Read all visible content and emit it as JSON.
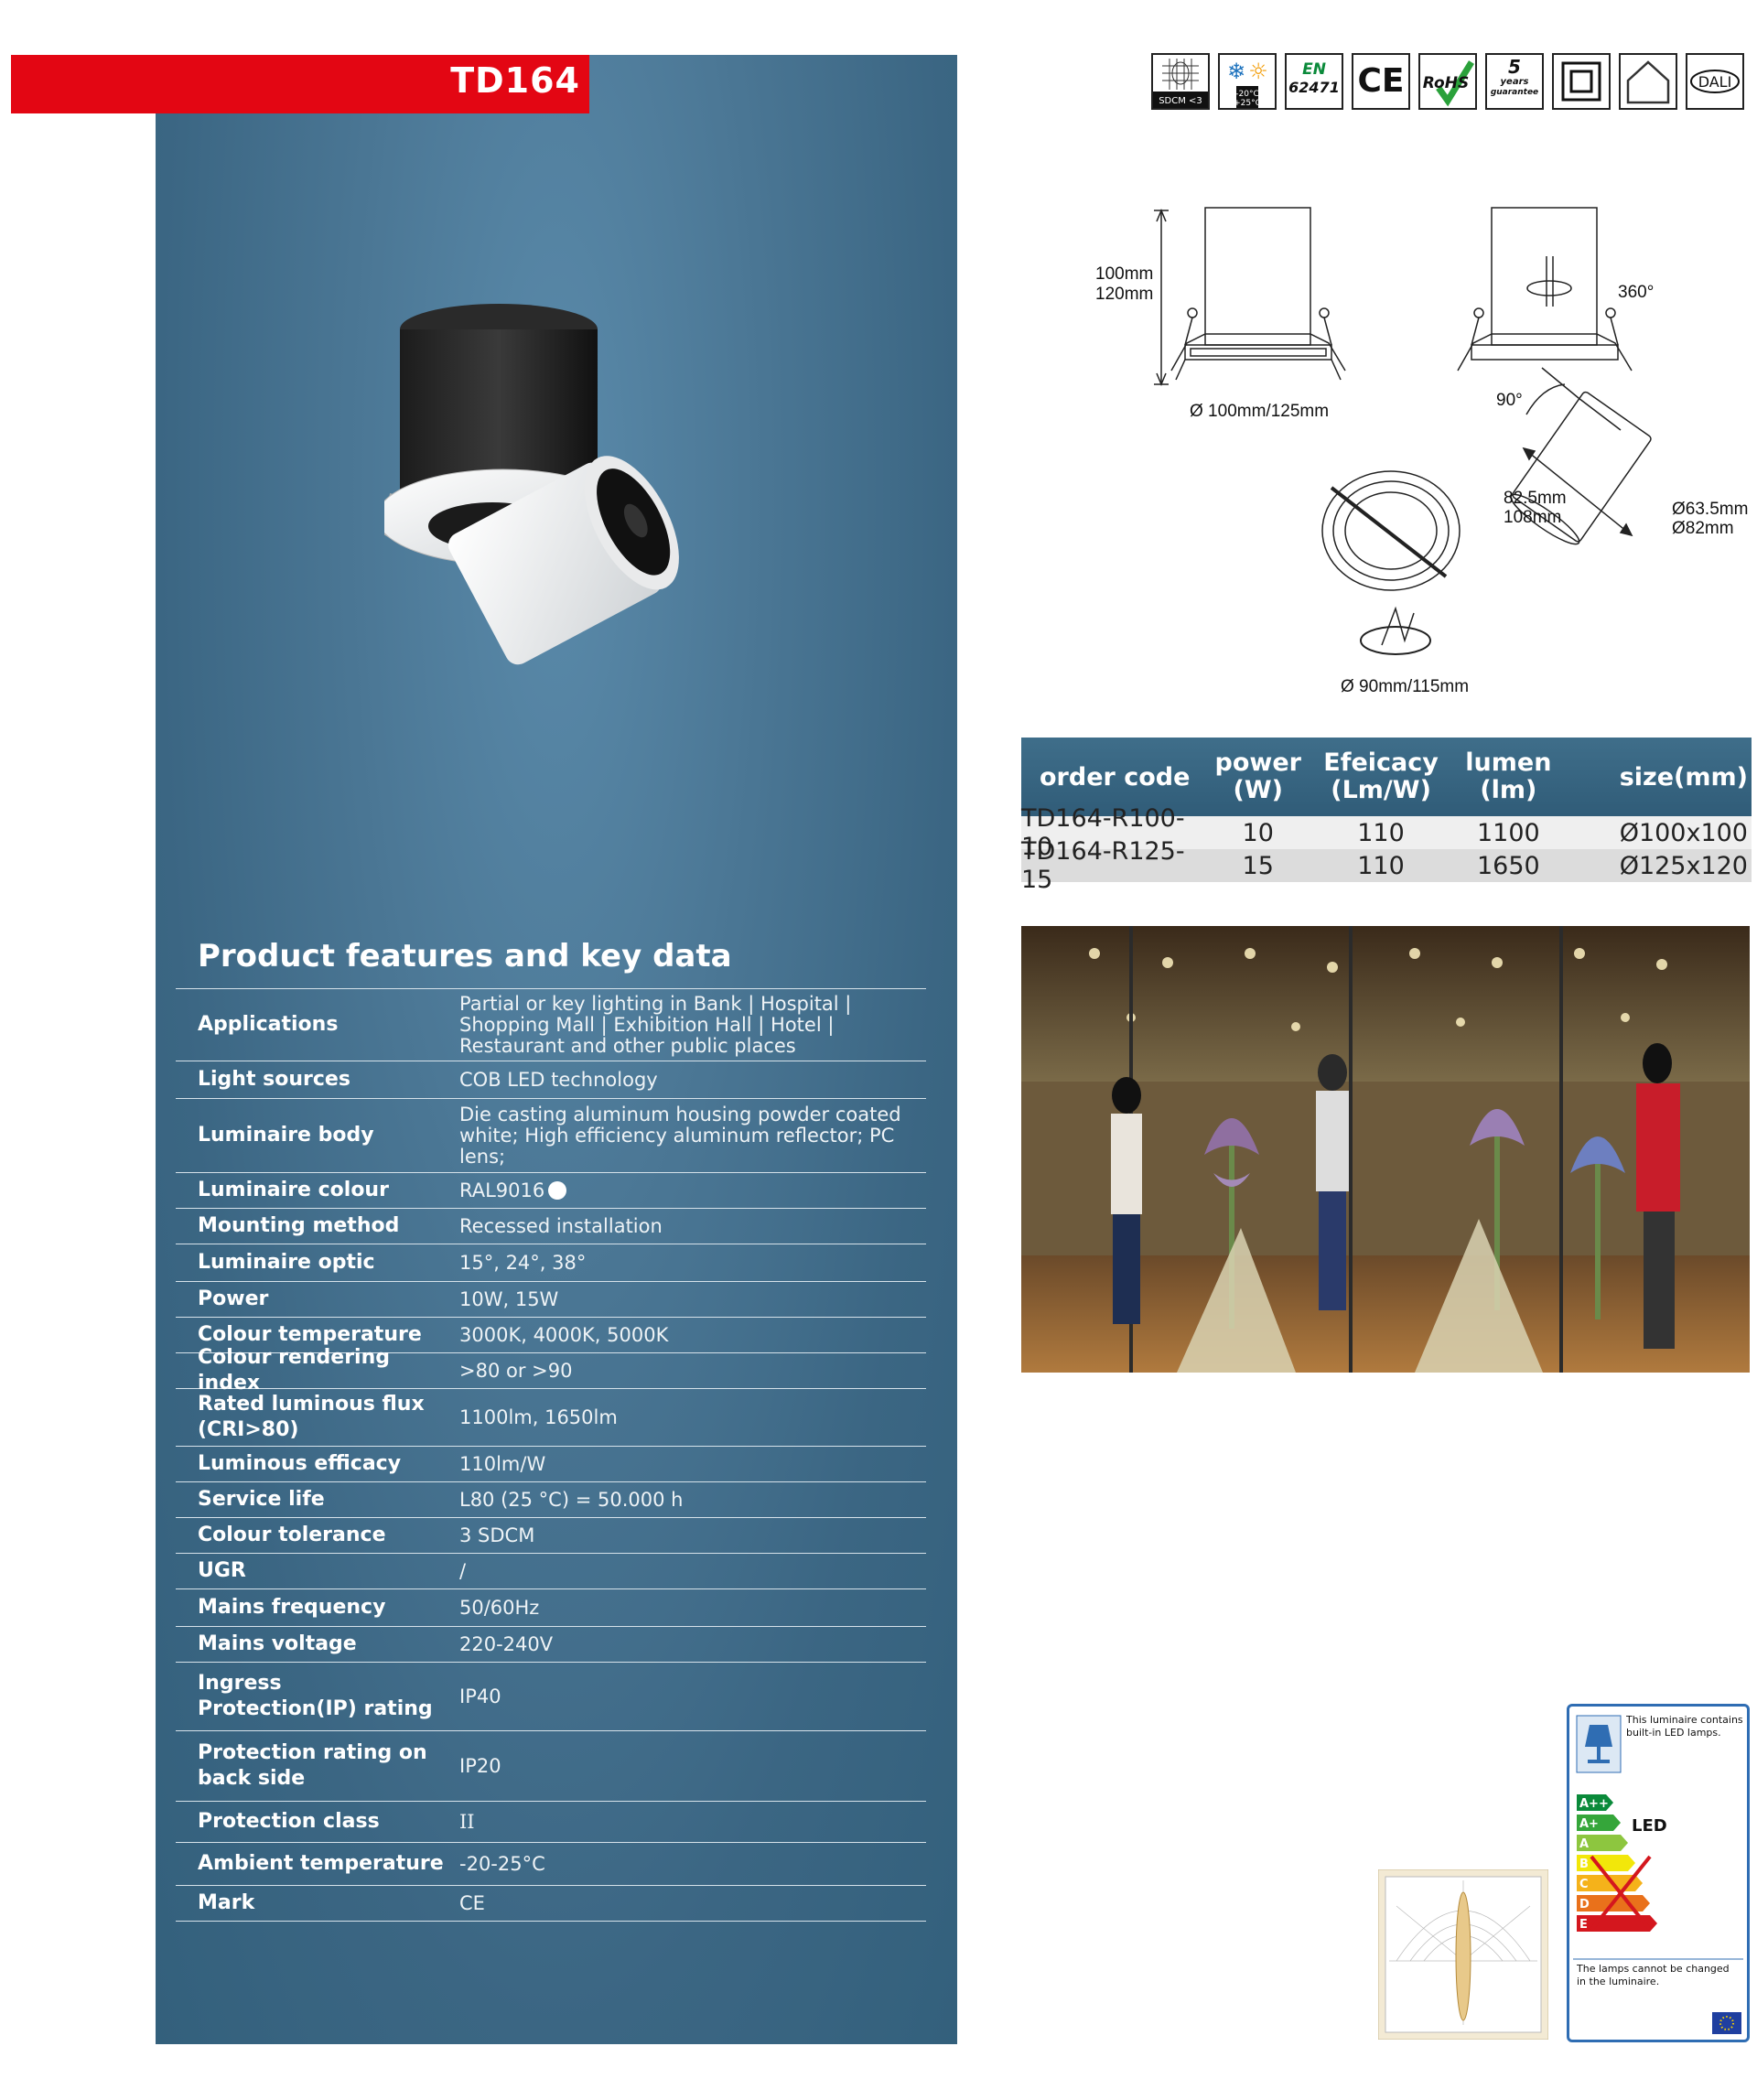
{
  "header": {
    "model": "TD164"
  },
  "certifications": [
    {
      "icon": "sdcm-icon",
      "label": "SDCM <3"
    },
    {
      "icon": "temperature-icon",
      "label": "-20°C\n+25°C"
    },
    {
      "icon": "en-standard-icon",
      "line1": "EN",
      "line2": "62471"
    },
    {
      "icon": "ce-icon",
      "label": "CE"
    },
    {
      "icon": "rohs-icon",
      "label": "RoHS"
    },
    {
      "icon": "warranty-icon",
      "line1": "5",
      "line2": "years",
      "line3": "guarantee"
    },
    {
      "icon": "class-ii-icon"
    },
    {
      "icon": "indoor-icon"
    },
    {
      "icon": "dali-icon",
      "label": "DALI"
    }
  ],
  "dimensions": {
    "height": "100mm",
    "height2": "120mm",
    "diameter": "Ø 100mm/125mm",
    "rotation": "360°",
    "tilt": "90°",
    "length": "82.5mm",
    "length2": "108mm",
    "head_diameter": "Ø63.5mm",
    "head_diameter2": "Ø82mm",
    "cutout": "Ø 90mm/115mm"
  },
  "order_table": {
    "headers": [
      "order code",
      "power\n(W)",
      "Efeicacy\n(Lm/W)",
      "lumen\n(lm)",
      "size(mm)"
    ],
    "rows": [
      [
        "TD164-R100-10",
        "10",
        "110",
        "1100",
        "Ø100x100"
      ],
      [
        "TD164-R125-15",
        "15",
        "110",
        "1650",
        "Ø125x120"
      ]
    ]
  },
  "features": {
    "title": "Product features and key data",
    "rows": [
      {
        "label": "Applications",
        "value": "Partial or key lighting in Bank | Hospital | Shopping Mall | Exhibition Hall | Hotel | Restaurant and other public places"
      },
      {
        "label": "Light sources",
        "value": "COB LED technology"
      },
      {
        "label": "Luminaire body",
        "value": "Die casting aluminum housing powder coated white; High efficiency aluminum reflector; PC lens;"
      },
      {
        "label": "Luminaire colour",
        "value": "RAL9016"
      },
      {
        "label": "Mounting method",
        "value": "Recessed installation"
      },
      {
        "label": "Luminaire optic",
        "value": "15°, 24°, 38°"
      },
      {
        "label": "Power",
        "value": "10W, 15W"
      },
      {
        "label": "Colour temperature",
        "value": "3000K, 4000K, 5000K"
      },
      {
        "label": "Colour rendering index",
        "value": ">80 or >90"
      },
      {
        "label": "Rated luminous flux (CRI>80)",
        "value": "1100lm, 1650lm"
      },
      {
        "label": "Luminous efficacy",
        "value": "110lm/W"
      },
      {
        "label": "Service life",
        "value": "L80 (25 °C) = 50.000 h"
      },
      {
        "label": "Colour tolerance",
        "value": "3 SDCM"
      },
      {
        "label": "UGR",
        "value": "/"
      },
      {
        "label": "Mains frequency",
        "value": "50/60Hz"
      },
      {
        "label": "Mains voltage",
        "value": "220-240V"
      },
      {
        "label": "Ingress Protection(IP) rating",
        "value": "IP40"
      },
      {
        "label": "Protection rating on back side",
        "value": "IP20"
      },
      {
        "label": "Protection class",
        "value": "II"
      },
      {
        "label": "Ambient temperature",
        "value": "-20-25°C"
      },
      {
        "label": "Mark",
        "value": "CE"
      }
    ]
  },
  "energy_label": {
    "top_text": "This luminaire contains built-in LED lamps.",
    "lamp_type": "LED",
    "classes": [
      "A++",
      "A+",
      "A",
      "B",
      "C",
      "D",
      "E"
    ],
    "bottom_text": "The lamps cannot be changed in the luminaire."
  },
  "colors": {
    "brand_red": "#e30613",
    "panel_blue": "#3f6e8a"
  }
}
